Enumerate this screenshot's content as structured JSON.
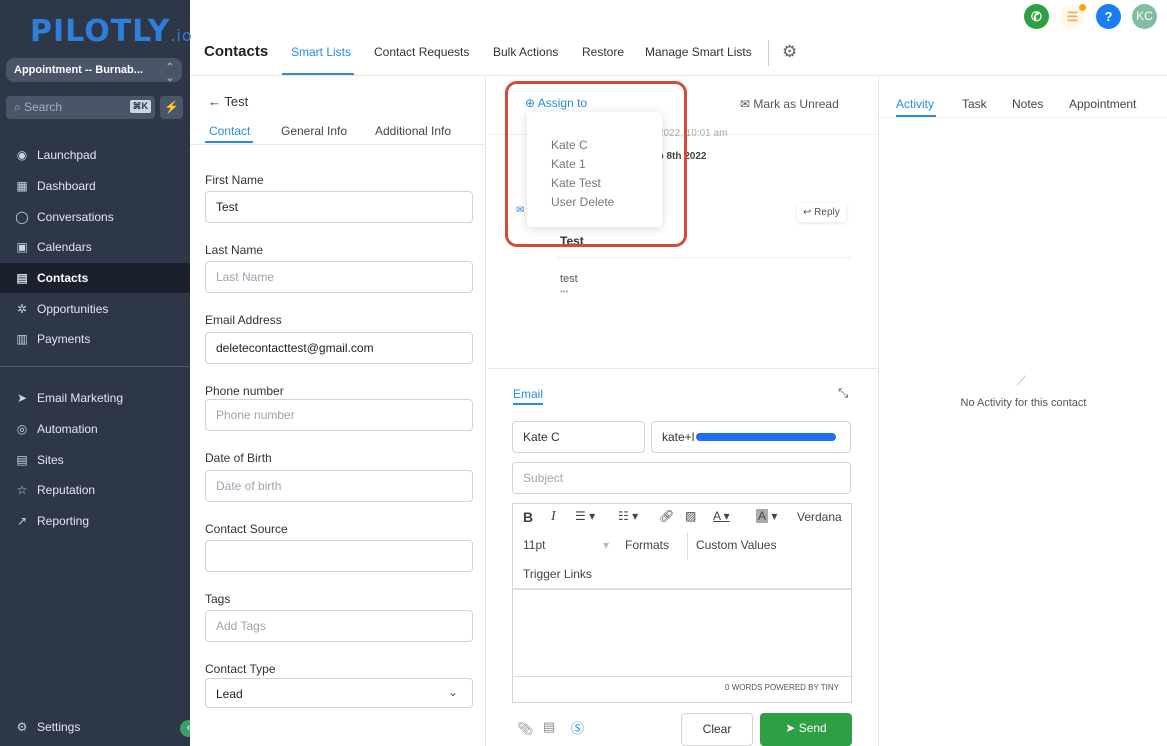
{
  "sidebar": {
    "logo": "PILOTLY",
    "logo_suffix": ".io",
    "location": "Appointment -- Burnab...",
    "search_placeholder": "Search",
    "shortcut": "⌘K",
    "items": [
      {
        "label": "Launchpad",
        "icon": "rocket-icon"
      },
      {
        "label": "Dashboard",
        "icon": "grid-icon"
      },
      {
        "label": "Conversations",
        "icon": "chat-icon"
      },
      {
        "label": "Calendars",
        "icon": "calendar-icon"
      },
      {
        "label": "Contacts",
        "icon": "contacts-icon"
      },
      {
        "label": "Opportunities",
        "icon": "funnel-icon"
      },
      {
        "label": "Payments",
        "icon": "receipt-icon"
      }
    ],
    "items2": [
      {
        "label": "Email Marketing",
        "icon": "send-icon"
      },
      {
        "label": "Automation",
        "icon": "automation-icon"
      },
      {
        "label": "Sites",
        "icon": "sites-icon"
      },
      {
        "label": "Reputation",
        "icon": "star-icon"
      },
      {
        "label": "Reporting",
        "icon": "chart-icon"
      }
    ],
    "settings": "Settings"
  },
  "header": {
    "title": "Contacts",
    "tabs": [
      "Smart Lists",
      "Contact Requests",
      "Bulk Actions",
      "Restore",
      "Manage Smart Lists"
    ],
    "avatar": "KC",
    "help": "?"
  },
  "contact": {
    "back_label": "Test",
    "tabs": [
      "Contact",
      "General Info",
      "Additional Info"
    ],
    "fields": [
      {
        "label": "First Name",
        "value": "Test",
        "placeholder": ""
      },
      {
        "label": "Last Name",
        "value": "",
        "placeholder": "Last Name"
      },
      {
        "label": "Email Address",
        "value": "deletecontacttest@gmail.com",
        "placeholder": ""
      },
      {
        "label": "Phone number",
        "value": "",
        "placeholder": "Phone number"
      },
      {
        "label": "Date of Birth",
        "value": "",
        "placeholder": "Date of birth"
      },
      {
        "label": "Contact Source",
        "value": "",
        "placeholder": ""
      },
      {
        "label": "Tags",
        "value": "",
        "placeholder": "Add Tags"
      },
      {
        "label": "Contact Type",
        "value": "Lead",
        "placeholder": ""
      }
    ]
  },
  "conversation": {
    "assign_label": "Assign to",
    "mark_unread": "Mark as Unread",
    "assign_options": [
      "Kate C",
      "Kate 1",
      "Kate Test",
      "User Delete"
    ],
    "date_partial": "08 2022, 10:01 am",
    "date_badge": "eb 8th 2022",
    "reply": "Reply",
    "subject": "Test",
    "body": "test",
    "ellipsis": "•••"
  },
  "composer": {
    "tab": "Email",
    "from_name": "Kate C",
    "to_email": "kate+l",
    "subject_placeholder": "Subject",
    "font": "Verdana",
    "size": "11pt",
    "formats": "Formats",
    "custom_values": "Custom Values",
    "trigger_links": "Trigger Links",
    "footer": "0 WORDS POWERED BY TINY",
    "clear": "Clear",
    "send": "Send"
  },
  "activity": {
    "tabs": [
      "Activity",
      "Task",
      "Notes",
      "Appointment"
    ],
    "empty": "No Activity for this contact"
  },
  "colors": {
    "accent": "#2b8be0",
    "sidebar": "#2d3748",
    "send": "#2ea043",
    "highlight": "#d9493a"
  }
}
